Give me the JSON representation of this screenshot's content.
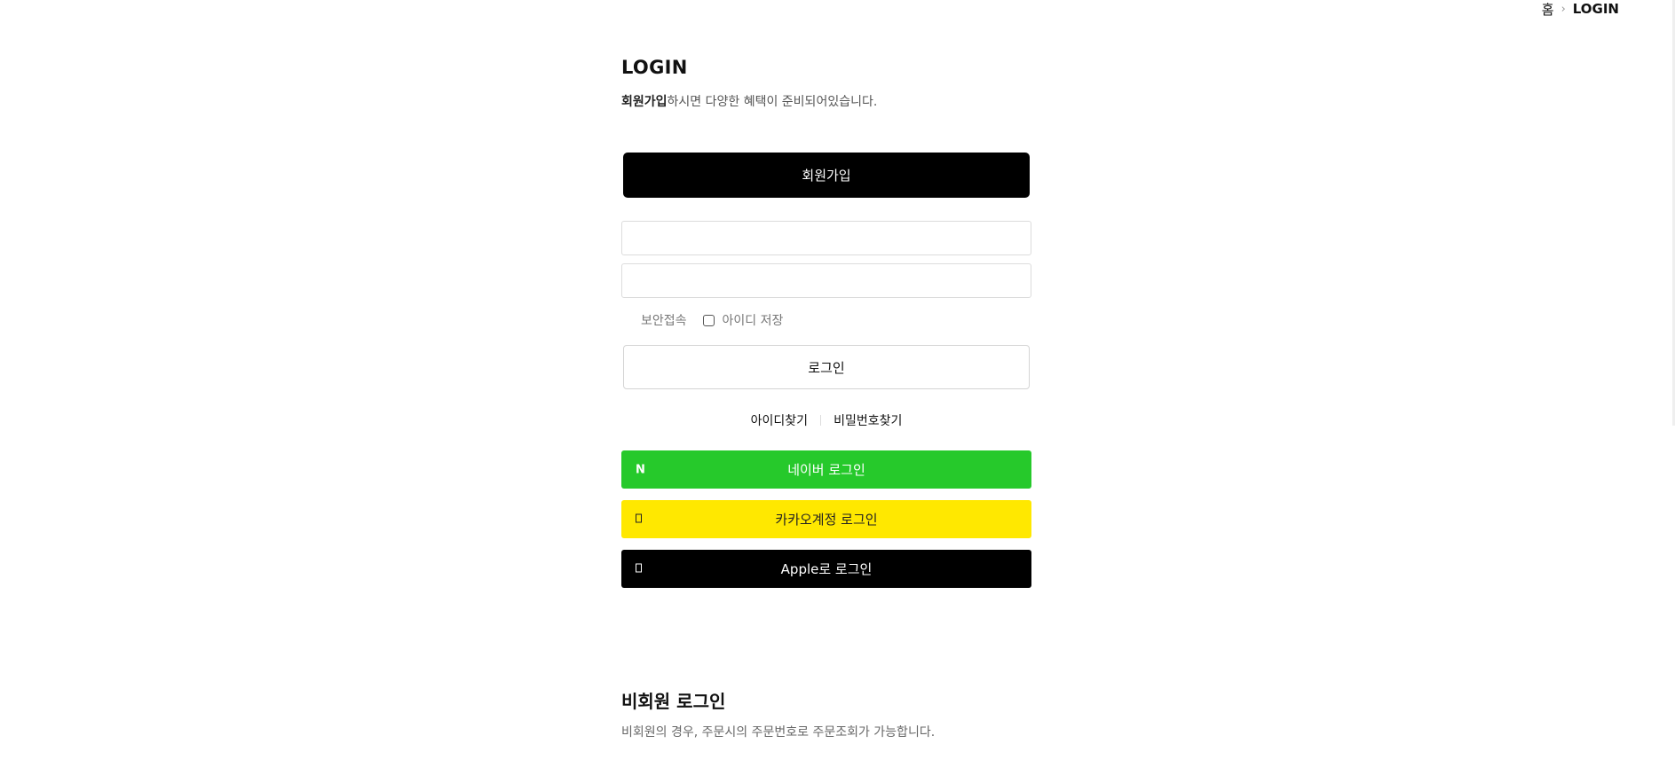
{
  "breadcrumb": {
    "home": "홈",
    "current": "LOGIN"
  },
  "login": {
    "title": "LOGIN",
    "subtitle_emphasis": "회원가입",
    "subtitle_rest": "하시면 다양한 혜택이 준비되어있습니다.",
    "join_button": "회원가입",
    "id_placeholder": "",
    "password_placeholder": "",
    "secure_label": "보안접속",
    "save_id_label": "아이디 저장",
    "save_id_checked": false,
    "login_button": "로그인",
    "find_id": "아이디찾기",
    "find_password": "비밀번호찾기"
  },
  "social": [
    {
      "key": "naver",
      "icon": "N",
      "label": "네이버 로그인",
      "bg": "#26c92b",
      "color": "#ffffff"
    },
    {
      "key": "kakao",
      "icon": "kakao-icon",
      "label": "카카오계정 로그인",
      "bg": "#ffe800",
      "color": "#222222"
    },
    {
      "key": "apple",
      "icon": "apple-icon",
      "label": "Apple로 로그인",
      "bg": "#000000",
      "color": "#ffffff"
    }
  ],
  "guest": {
    "title": "비회원 로그인",
    "description": "비회원의 경우, 주문시의 주문번호로 주문조회가 가능합니다."
  }
}
